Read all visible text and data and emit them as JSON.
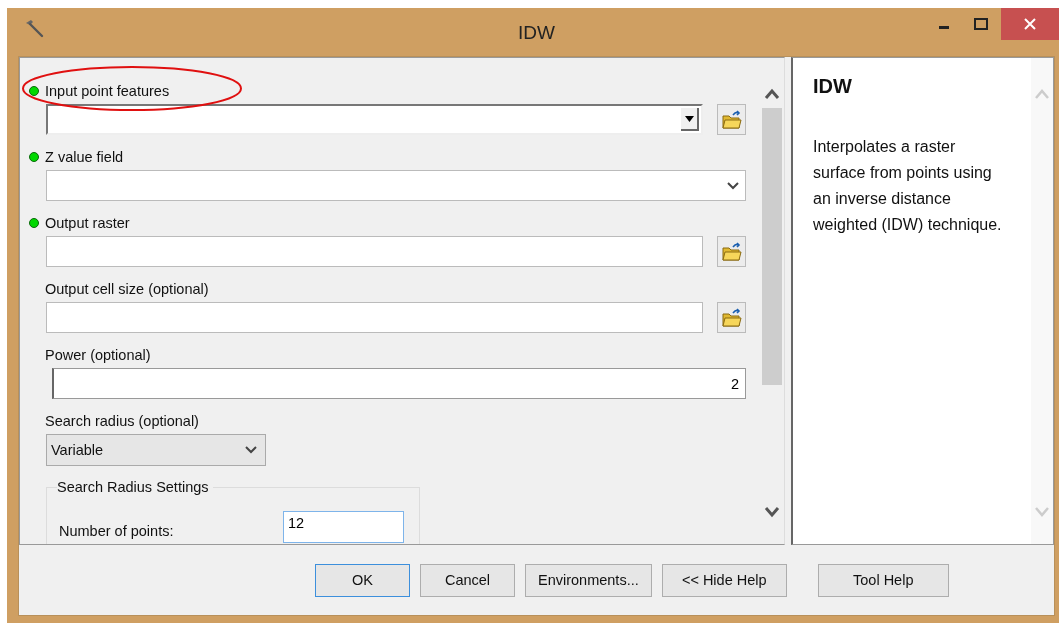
{
  "window": {
    "title": "IDW"
  },
  "params": [
    {
      "kind": "combo-browse",
      "label": "Input point features",
      "required": true,
      "highlighted": true
    },
    {
      "kind": "dropdown",
      "label": "Z value field",
      "required": true,
      "highlighted": false
    },
    {
      "kind": "text-browse",
      "label": "Output raster",
      "required": true,
      "highlighted": false
    },
    {
      "kind": "text-browse",
      "label": "Output cell size (optional)",
      "required": false,
      "highlighted": false
    },
    {
      "kind": "text",
      "label": "Power (optional)",
      "required": false,
      "highlighted": false,
      "value": "2"
    },
    {
      "kind": "select",
      "label": "Search radius (optional)",
      "required": false,
      "highlighted": false,
      "value": "Variable"
    },
    {
      "kind": "group",
      "title": "Search Radius Settings",
      "fields": [
        {
          "label": "Number of points:",
          "value": "12"
        }
      ]
    }
  ],
  "help": {
    "title": "IDW",
    "description": "Interpolates a raster surface from points using an inverse distance weighted (IDW) technique."
  },
  "buttons": [
    {
      "label": "OK",
      "default": true
    },
    {
      "label": "Cancel",
      "default": false
    },
    {
      "label": "Environments...",
      "default": false
    },
    {
      "label": "<< Hide Help",
      "default": false
    },
    {
      "label": "Tool Help",
      "default": false
    }
  ]
}
